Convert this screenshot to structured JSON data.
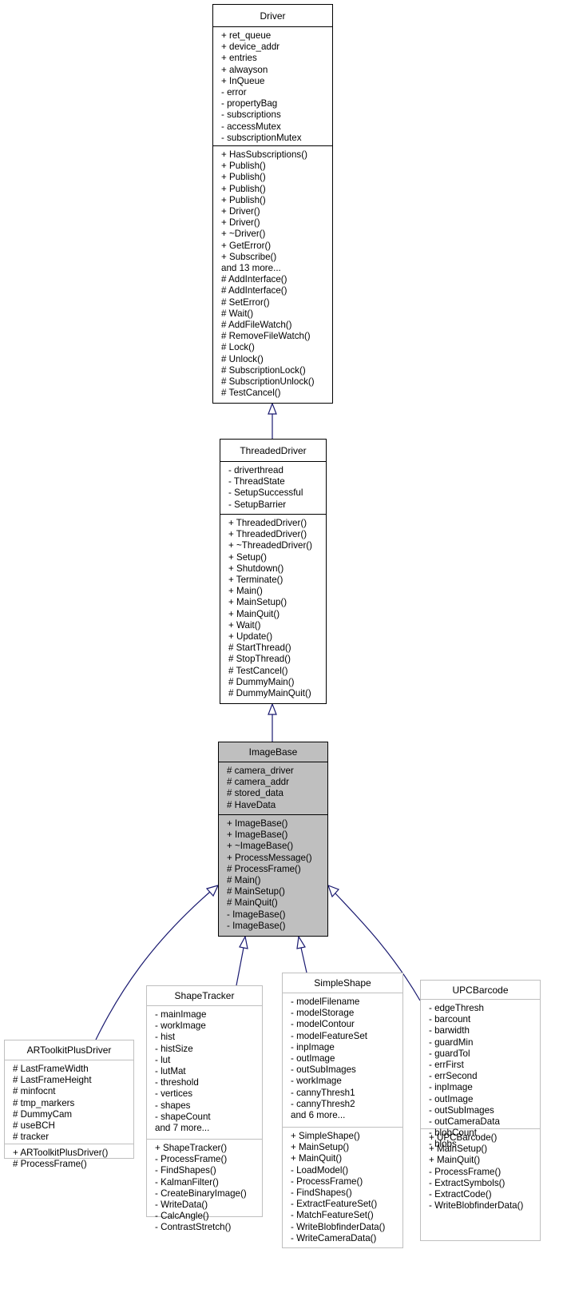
{
  "diagram": {
    "type": "class-inheritance-graph",
    "edge_color": "#191970",
    "focus_fill": "#bfbfbf",
    "classes": {
      "driver": {
        "name": "Driver",
        "attributes": [
          "+ ret_queue",
          "+ device_addr",
          "+ entries",
          "+ alwayson",
          "+ InQueue",
          "- error",
          "- propertyBag",
          "- subscriptions",
          "- accessMutex",
          "- subscriptionMutex"
        ],
        "methods": [
          "+ HasSubscriptions()",
          "+ Publish()",
          "+ Publish()",
          "+ Publish()",
          "+ Publish()",
          "+ Driver()",
          "+ Driver()",
          "+ ~Driver()",
          "+ GetError()",
          "+ Subscribe()",
          "and 13 more...",
          "# AddInterface()",
          "# AddInterface()",
          "# SetError()",
          "# Wait()",
          "# AddFileWatch()",
          "# RemoveFileWatch()",
          "# Lock()",
          "# Unlock()",
          "# SubscriptionLock()",
          "# SubscriptionUnlock()",
          "# TestCancel()"
        ]
      },
      "threaded_driver": {
        "name": "ThreadedDriver",
        "attributes": [
          "- driverthread",
          "- ThreadState",
          "- SetupSuccessful",
          "- SetupBarrier"
        ],
        "methods": [
          "+ ThreadedDriver()",
          "+ ThreadedDriver()",
          "+ ~ThreadedDriver()",
          "+ Setup()",
          "+ Shutdown()",
          "+ Terminate()",
          "+ Main()",
          "+ MainSetup()",
          "+ MainQuit()",
          "+ Wait()",
          "+ Update()",
          "# StartThread()",
          "# StopThread()",
          "# TestCancel()",
          "# DummyMain()",
          "# DummyMainQuit()"
        ]
      },
      "image_base": {
        "name": "ImageBase",
        "attributes": [
          "# camera_driver",
          "# camera_addr",
          "# stored_data",
          "# HaveData"
        ],
        "methods": [
          "+ ImageBase()",
          "+ ImageBase()",
          "+ ~ImageBase()",
          "+ ProcessMessage()",
          "# ProcessFrame()",
          "# Main()",
          "# MainSetup()",
          "# MainQuit()",
          "- ImageBase()",
          "- ImageBase()"
        ]
      },
      "artoolkit": {
        "name": "ARToolkitPlusDriver",
        "attributes": [
          "# LastFrameWidth",
          "# LastFrameHeight",
          "# minfocnt",
          "# tmp_markers",
          "# DummyCam",
          "# useBCH",
          "# tracker"
        ],
        "methods": [
          "+ ARToolkitPlusDriver()",
          "# ProcessFrame()"
        ]
      },
      "shape_tracker": {
        "name": "ShapeTracker",
        "attributes": [
          "- mainImage",
          "- workImage",
          "- hist",
          "- histSize",
          "- lut",
          "- lutMat",
          "- threshold",
          "- vertices",
          "- shapes",
          "- shapeCount",
          "and 7 more..."
        ],
        "methods": [
          "+ ShapeTracker()",
          "- ProcessFrame()",
          "- FindShapes()",
          "- KalmanFilter()",
          "- CreateBinaryImage()",
          "- WriteData()",
          "- CalcAngle()",
          "- ContrastStretch()"
        ]
      },
      "simple_shape": {
        "name": "SimpleShape",
        "attributes": [
          "- modelFilename",
          "- modelStorage",
          "- modelContour",
          "- modelFeatureSet",
          "- inpImage",
          "- outImage",
          "- outSubImages",
          "- workImage",
          "- cannyThresh1",
          "- cannyThresh2",
          "and 6 more..."
        ],
        "methods": [
          "+ SimpleShape()",
          "+ MainSetup()",
          "+ MainQuit()",
          "- LoadModel()",
          "- ProcessFrame()",
          "- FindShapes()",
          "- ExtractFeatureSet()",
          "- MatchFeatureSet()",
          "- WriteBlobfinderData()",
          "- WriteCameraData()"
        ]
      },
      "upc_barcode": {
        "name": "UPCBarcode",
        "attributes": [
          "- edgeThresh",
          "- barcount",
          "- barwidth",
          "- guardMin",
          "- guardTol",
          "- errFirst",
          "- errSecond",
          "- inpImage",
          "- outImage",
          "- outSubImages",
          "- outCameraData",
          "- blobCount",
          "- blobs"
        ],
        "methods": [
          "+ UPCBarcode()",
          "+ MainSetup()",
          "+ MainQuit()",
          "- ProcessFrame()",
          "- ExtractSymbols()",
          "- ExtractCode()",
          "- WriteBlobfinderData()"
        ]
      }
    },
    "edges": [
      {
        "from": "ThreadedDriver",
        "to": "Driver",
        "kind": "inherits"
      },
      {
        "from": "ImageBase",
        "to": "ThreadedDriver",
        "kind": "inherits"
      },
      {
        "from": "ARToolkitPlusDriver",
        "to": "ImageBase",
        "kind": "inherits"
      },
      {
        "from": "ShapeTracker",
        "to": "ImageBase",
        "kind": "inherits"
      },
      {
        "from": "SimpleShape",
        "to": "ImageBase",
        "kind": "inherits"
      },
      {
        "from": "UPCBarcode",
        "to": "ImageBase",
        "kind": "inherits"
      }
    ]
  }
}
